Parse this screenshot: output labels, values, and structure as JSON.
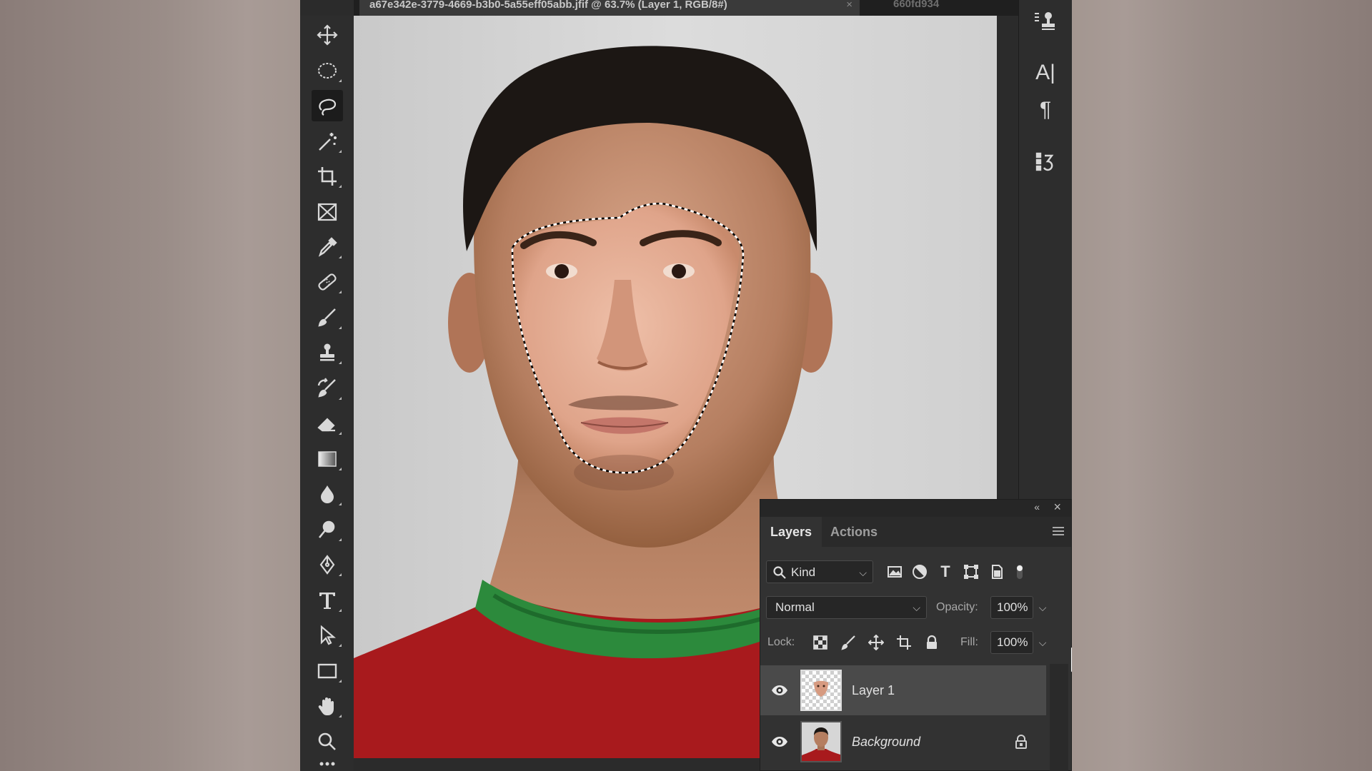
{
  "document": {
    "tab_title": "a67e342e-3779-4669-b3b0-5a55eff05abb.jfif @ 63.7% (Layer 1, RGB/8#)",
    "close_glyph": "×",
    "second_tab": "660fd934",
    "more_glyph": "»"
  },
  "toolbar": {
    "tools": [
      {
        "name": "move-tool",
        "icon": "move-icon",
        "active": false
      },
      {
        "name": "elliptical-marquee-tool",
        "icon": "ellipse-marquee-icon",
        "active": false
      },
      {
        "name": "lasso-tool",
        "icon": "lasso-icon",
        "active": true
      },
      {
        "name": "magic-wand-tool",
        "icon": "magic-wand-icon",
        "active": false
      },
      {
        "name": "crop-tool",
        "icon": "crop-icon",
        "active": false
      },
      {
        "name": "frame-tool",
        "icon": "frame-icon",
        "active": false
      },
      {
        "name": "eyedropper-tool",
        "icon": "eyedropper-icon",
        "active": false
      },
      {
        "name": "healing-brush-tool",
        "icon": "bandage-icon",
        "active": false
      },
      {
        "name": "brush-tool",
        "icon": "brush-icon",
        "active": false
      },
      {
        "name": "clone-stamp-tool",
        "icon": "stamp-icon",
        "active": false
      },
      {
        "name": "history-brush-tool",
        "icon": "history-brush-icon",
        "active": false
      },
      {
        "name": "eraser-tool",
        "icon": "eraser-icon",
        "active": false
      },
      {
        "name": "gradient-tool",
        "icon": "gradient-icon",
        "active": false
      },
      {
        "name": "blur-tool",
        "icon": "drop-icon",
        "active": false
      },
      {
        "name": "dodge-tool",
        "icon": "dodge-icon",
        "active": false
      },
      {
        "name": "pen-tool",
        "icon": "pen-icon",
        "active": false
      },
      {
        "name": "type-tool",
        "icon": "type-icon",
        "active": false
      },
      {
        "name": "path-selection-tool",
        "icon": "arrow-icon",
        "active": false
      },
      {
        "name": "rectangle-tool",
        "icon": "rectangle-icon",
        "active": false
      },
      {
        "name": "hand-tool",
        "icon": "hand-icon",
        "active": false
      },
      {
        "name": "zoom-tool",
        "icon": "zoom-icon",
        "active": false
      }
    ]
  },
  "right_strip": {
    "character_glyph": "A|",
    "paragraph_glyph": "¶"
  },
  "layers_panel": {
    "tabs": [
      "Layers",
      "Actions"
    ],
    "active_tab": "Layers",
    "collapse_glyph": "«",
    "close_glyph": "×",
    "filter": {
      "kind_label": "Kind",
      "type_glyph": "T"
    },
    "blend_mode": "Normal",
    "opacity_label": "Opacity:",
    "opacity_value": "100%",
    "lock_label": "Lock:",
    "fill_label": "Fill:",
    "fill_value": "100%",
    "layers": [
      {
        "name": "Layer 1",
        "visible": true,
        "selected": true,
        "locked": false
      },
      {
        "name": "Background",
        "visible": true,
        "selected": false,
        "locked": true
      }
    ]
  },
  "colors": {
    "panel_bg": "#323232",
    "selected_row": "#4a4a4a",
    "jersey_red": "#a81a1d",
    "jersey_green": "#2c8a3c",
    "canvas_bg": "#d4d4d4"
  }
}
